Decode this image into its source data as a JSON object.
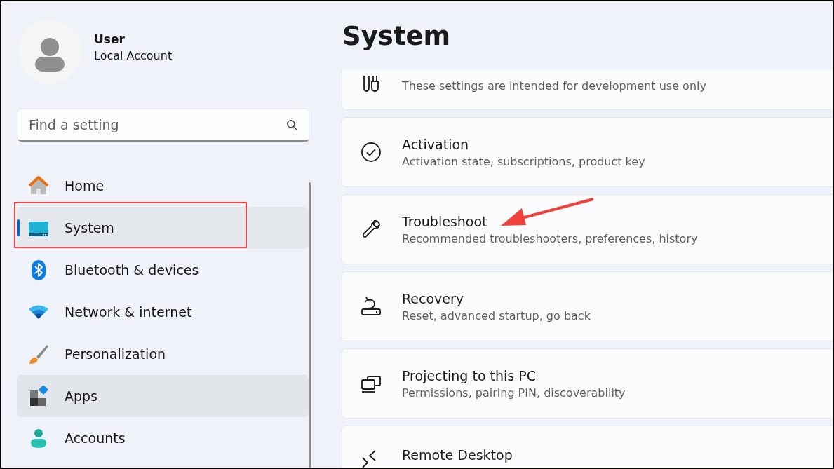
{
  "account": {
    "name": "User",
    "type": "Local Account"
  },
  "search": {
    "placeholder": "Find a setting"
  },
  "nav": [
    {
      "label": "Home",
      "selected": false,
      "hovered": false,
      "outlined": false
    },
    {
      "label": "System",
      "selected": true,
      "hovered": false,
      "outlined": true
    },
    {
      "label": "Bluetooth & devices",
      "selected": false,
      "hovered": false,
      "outlined": false
    },
    {
      "label": "Network & internet",
      "selected": false,
      "hovered": false,
      "outlined": false
    },
    {
      "label": "Personalization",
      "selected": false,
      "hovered": false,
      "outlined": false
    },
    {
      "label": "Apps",
      "selected": false,
      "hovered": true,
      "outlined": false
    },
    {
      "label": "Accounts",
      "selected": false,
      "hovered": false,
      "outlined": false
    }
  ],
  "page_title": "System",
  "cards": [
    {
      "description": "These settings are intended for development use only",
      "pointed": false
    },
    {
      "title": "Activation",
      "description": "Activation state, subscriptions, product key",
      "pointed": false
    },
    {
      "title": "Troubleshoot",
      "description": "Recommended troubleshooters, preferences, history",
      "pointed": true
    },
    {
      "title": "Recovery",
      "description": "Reset, advanced startup, go back",
      "pointed": false
    },
    {
      "title": "Projecting to this PC",
      "description": "Permissions, pairing PIN, discoverability",
      "pointed": false
    },
    {
      "title": "Remote Desktop",
      "pointed": false
    }
  ]
}
